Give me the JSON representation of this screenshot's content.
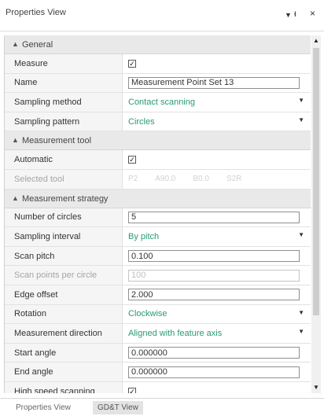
{
  "window": {
    "title": "Properties View",
    "dropdown_icon": "▼",
    "pin_icon": "ᵻ",
    "close_icon": "×"
  },
  "sections": {
    "general": {
      "title": "General",
      "measure_label": "Measure",
      "measure_checked": true,
      "name_label": "Name",
      "name_value": "Measurement Point Set 13",
      "sampling_method_label": "Sampling method",
      "sampling_method_value": "Contact scanning",
      "sampling_pattern_label": "Sampling pattern",
      "sampling_pattern_value": "Circles"
    },
    "tool": {
      "title": "Measurement tool",
      "automatic_label": "Automatic",
      "automatic_checked": true,
      "selected_tool_label": "Selected tool",
      "selected_tool_values": [
        "P2",
        "A90.0",
        "B0.0",
        "S2R"
      ]
    },
    "strategy": {
      "title": "Measurement strategy",
      "num_circles_label": "Number of circles",
      "num_circles_value": "5",
      "sampling_interval_label": "Sampling interval",
      "sampling_interval_value": "By pitch",
      "scan_pitch_label": "Scan pitch",
      "scan_pitch_value": "0.100",
      "scan_points_label": "Scan points per circle",
      "scan_points_value": "100",
      "edge_offset_label": "Edge offset",
      "edge_offset_value": "2.000",
      "rotation_label": "Rotation",
      "rotation_value": "Clockwise",
      "direction_label": "Measurement direction",
      "direction_value": "Aligned with feature axis",
      "start_angle_label": "Start angle",
      "start_angle_value": "0.000000",
      "end_angle_label": "End angle",
      "end_angle_value": "0.000000",
      "high_speed_label": "High speed scanning",
      "high_speed_checked": true
    }
  },
  "tabs": {
    "properties": "Properties View",
    "gdt": "GD&T View"
  },
  "colors": {
    "dropdown_value": "#2a9a72",
    "section_bg": "#e9e9e9"
  }
}
